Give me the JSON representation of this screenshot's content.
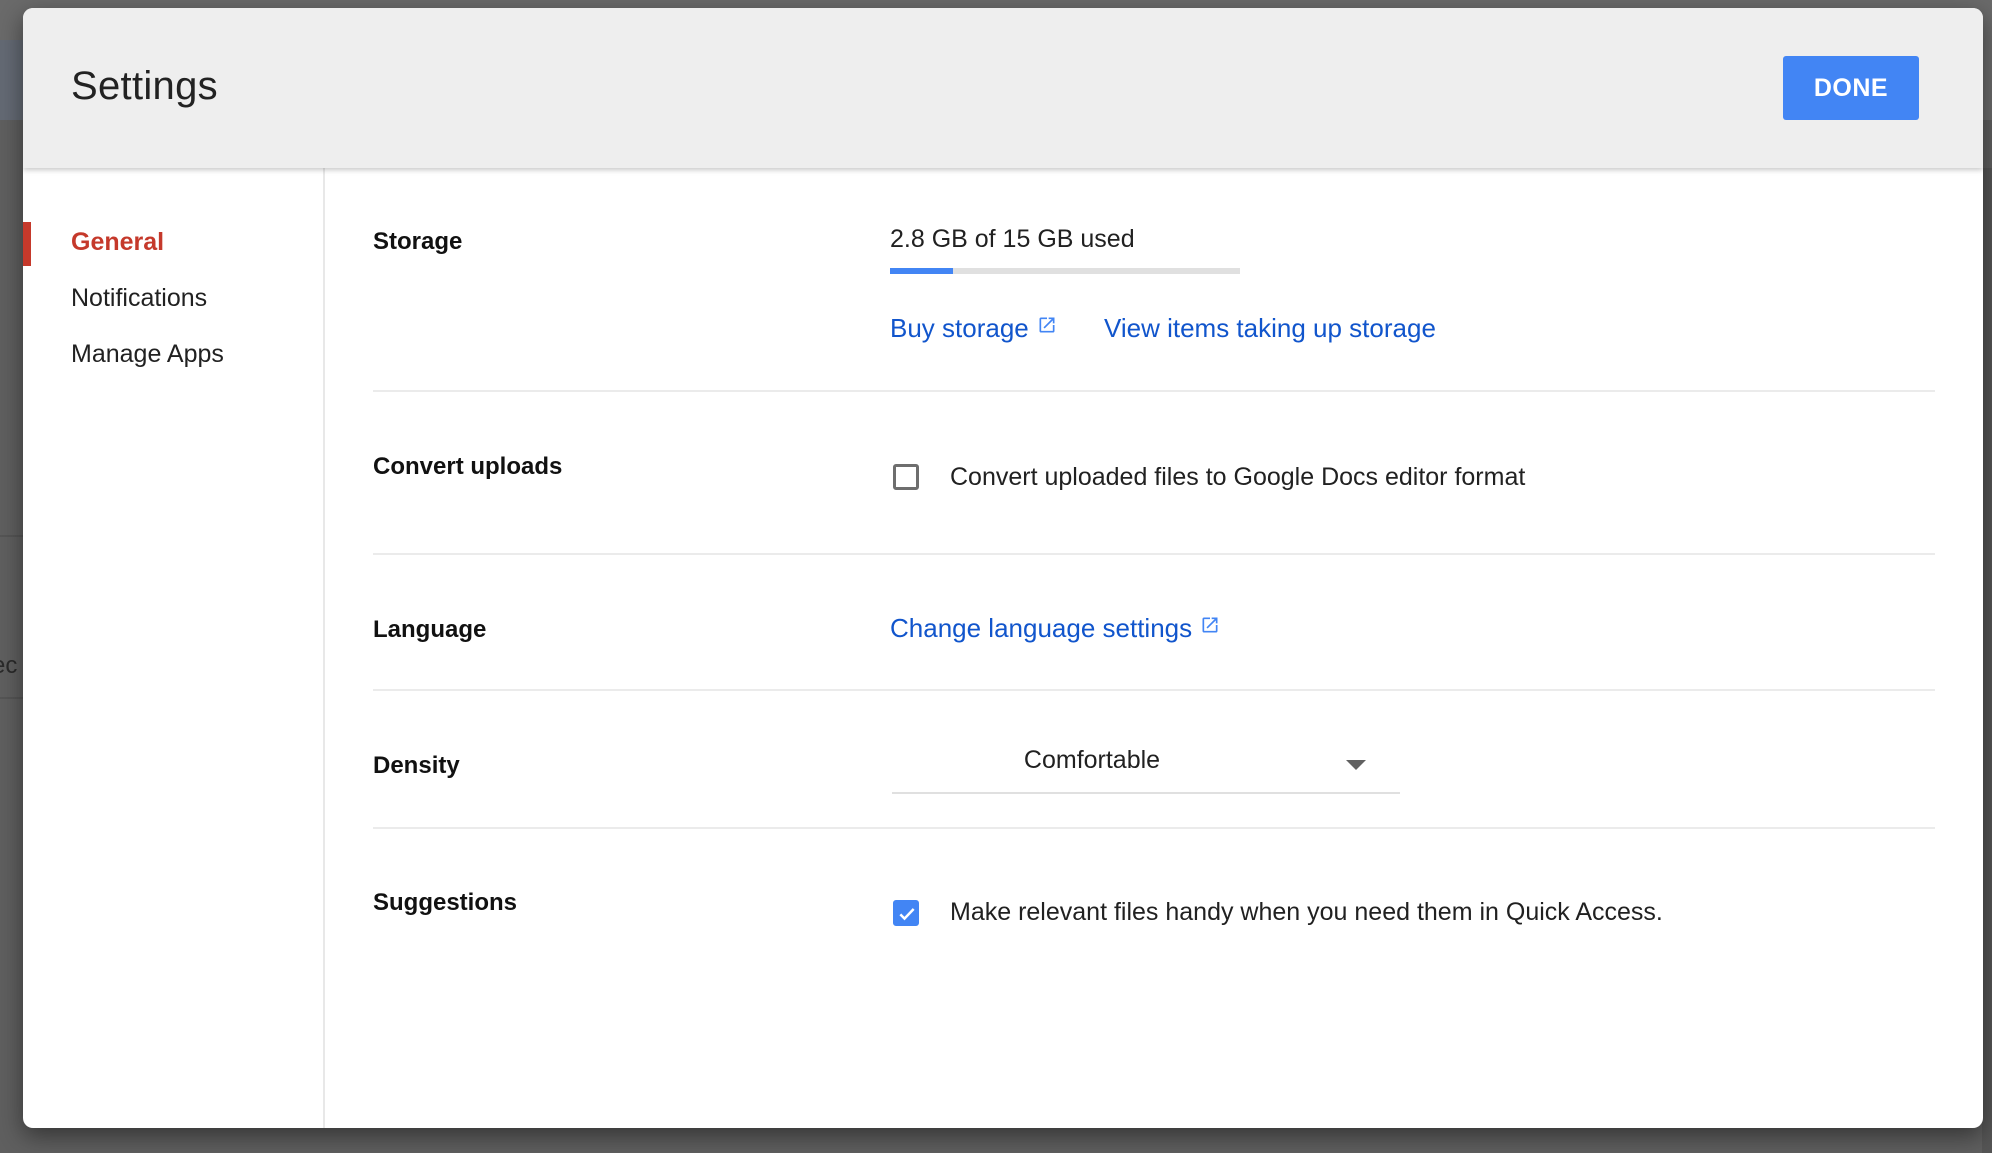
{
  "background": {
    "partial_text": "ec"
  },
  "dialog": {
    "title": "Settings",
    "done_label": "DONE"
  },
  "sidebar": {
    "items": [
      {
        "label": "General",
        "active": true
      },
      {
        "label": "Notifications",
        "active": false
      },
      {
        "label": "Manage Apps",
        "active": false
      }
    ]
  },
  "sections": {
    "storage": {
      "label": "Storage",
      "usage_text": "2.8 GB of 15 GB used",
      "used_gb": 2.8,
      "total_gb": 15,
      "used_fraction": 0.18,
      "buy_storage_label": "Buy storage",
      "view_items_label": "View items taking up storage"
    },
    "convert_uploads": {
      "label": "Convert uploads",
      "checkbox_label": "Convert uploaded files to Google Docs editor format",
      "checked": false
    },
    "language": {
      "label": "Language",
      "link_label": "Change language settings"
    },
    "density": {
      "label": "Density",
      "selected": "Comfortable"
    },
    "suggestions": {
      "label": "Suggestions",
      "checkbox_label": "Make relevant files handy when you need them in Quick Access.",
      "checked": true
    }
  },
  "colors": {
    "accent_blue": "#4285f4",
    "link_blue": "#1155cc",
    "active_red": "#c5392b",
    "header_bg": "#eeeeee"
  }
}
